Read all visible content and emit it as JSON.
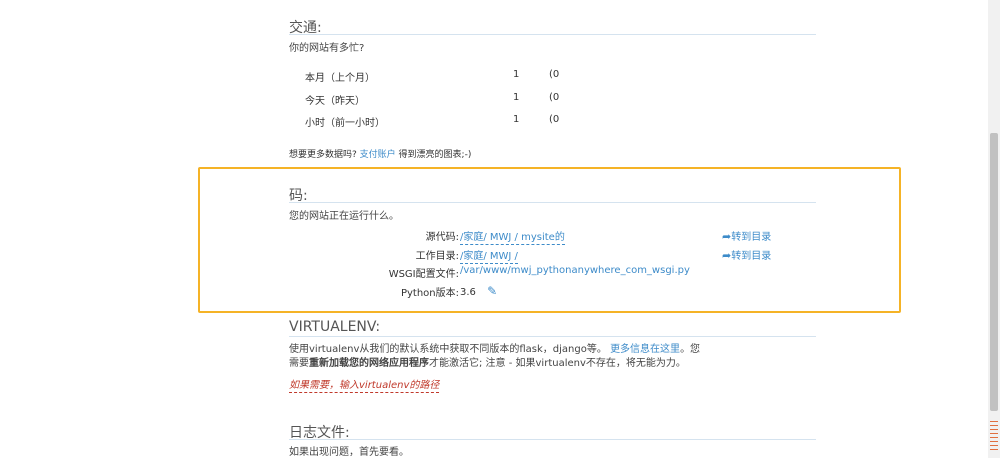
{
  "traffic": {
    "title": "交通:",
    "subtitle": "你的网站有多忙?",
    "rows": [
      {
        "label": "本月（上个月）",
        "value": "1",
        "prev": "(0"
      },
      {
        "label": "今天（昨天）",
        "value": "1",
        "prev": "(0"
      },
      {
        "label": "小时（前一小时）",
        "value": "1",
        "prev": "(0"
      }
    ],
    "more_prefix": "想要更多数据吗?",
    "more_link": "支付账户",
    "more_suffix": "得到漂亮的图表;-)"
  },
  "code": {
    "title": "码:",
    "subtitle": "您的网站正在运行什么。",
    "source_label": "源代码:",
    "source_value": "/家庭/ MWJ / mysite的",
    "workdir_label": "工作目录:",
    "workdir_value": "/家庭/ MWJ /",
    "wsgi_label": "WSGI配置文件:",
    "wsgi_value": "/var/www/mwj_pythonanywhere_com_wsgi.py",
    "python_label": "Python版本:",
    "python_value": "3.6",
    "goto_label": "转到目录",
    "accent_color": "#f5b326"
  },
  "virtualenv": {
    "title": "VIRTUALENV:",
    "line1_prefix": "使用virtualenv从我们的默认系统中获取不同版本的flask，django等。",
    "line1_link": "更多信息在这里",
    "line1_suffix": "。您",
    "line2_prefix": "需要",
    "line2_bold": "重新加载您的网络应用程序",
    "line2_suffix": "才能激活它; 注意 - 如果virtualenv不存在，将无能为力。",
    "input_placeholder": "如果需要，输入virtualenv的路径"
  },
  "logs": {
    "title": "日志文件:",
    "subtitle": "如果出现问题，首先要看。"
  },
  "colors": {
    "link": "#3d8bc9",
    "warning": "#c0392b"
  }
}
